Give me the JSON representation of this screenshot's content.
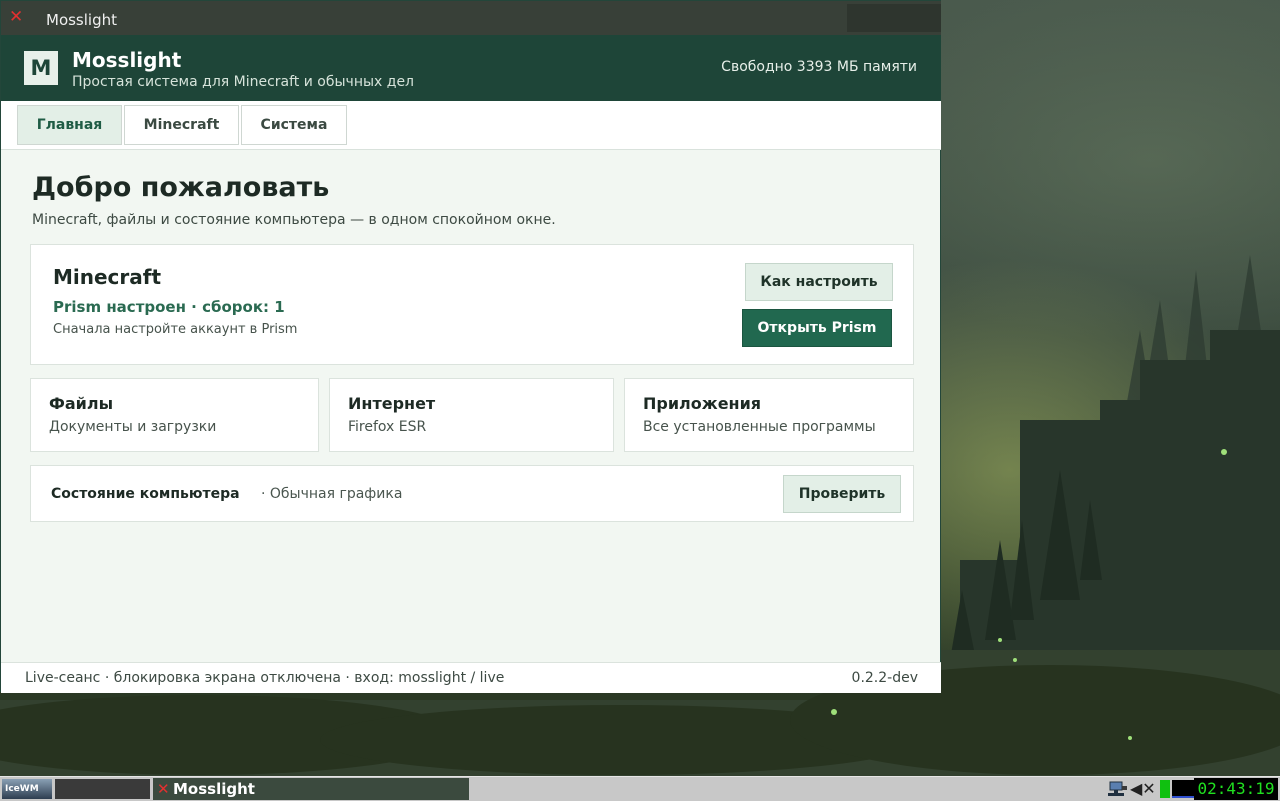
{
  "window": {
    "title": "Mosslight",
    "close_icon": "x-close-icon"
  },
  "header": {
    "logo_letter": "M",
    "app_name": "Mosslight",
    "subtitle": "Простая система для Minecraft и обычных дел",
    "memory": "Свободно 3393 МБ памяти"
  },
  "tabs": [
    {
      "label": "Главная",
      "active": true
    },
    {
      "label": "Minecraft",
      "active": false
    },
    {
      "label": "Система",
      "active": false
    }
  ],
  "main": {
    "title": "Добро пожаловать",
    "description": "Minecraft, файлы и состояние компьютера — в одном спокойном окне."
  },
  "minecraft_card": {
    "title": "Minecraft",
    "status": "Prism настроен · сборок: 1",
    "hint": "Сначала настройте аккаунт в Prism",
    "howto_button": "Как настроить",
    "open_button": "Открыть Prism"
  },
  "cards": {
    "files": {
      "title": "Файлы",
      "desc": "Документы и загрузки"
    },
    "internet": {
      "title": "Интернет",
      "desc": "Firefox ESR"
    },
    "apps": {
      "title": "Приложения",
      "desc": "Все установленные программы"
    }
  },
  "status_card": {
    "title": "Состояние компьютера",
    "extra": "· Обычная графика",
    "check_button": "Проверить"
  },
  "footer": {
    "left": "Live-сеанс · блокировка экрана отключена · вход: mosslight / live",
    "right": "0.2.2-dev"
  },
  "taskbar": {
    "start_label": "IceWM",
    "task_title": "Mosslight",
    "clock": "02:43:19",
    "icons": [
      "network-icon",
      "volume-muted-icon",
      "cpu-meter",
      "memory-meter"
    ]
  },
  "colors": {
    "header_bg": "#1e4538",
    "accent": "#21684f",
    "status_green": "#2a6a51"
  }
}
